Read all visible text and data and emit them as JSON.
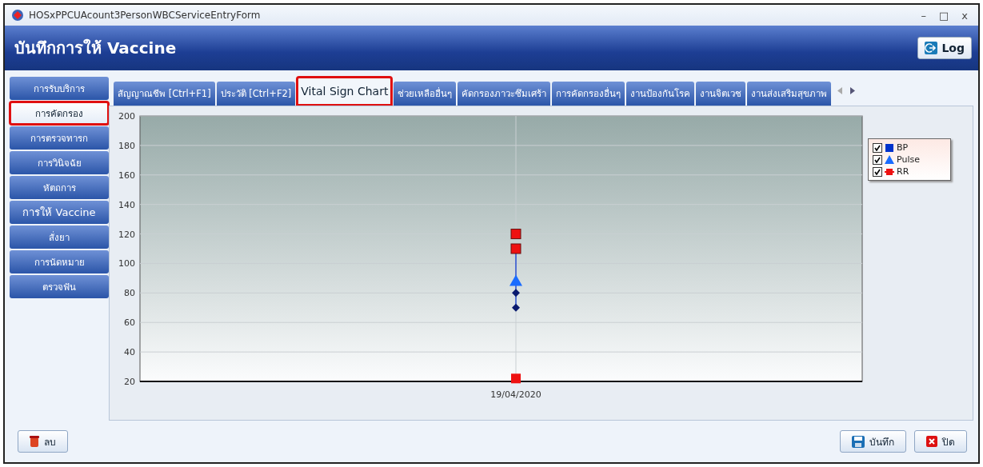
{
  "window": {
    "title": "HOSxPPCUAcount3PersonWBCServiceEntryForm",
    "controls": [
      "–",
      "□",
      "x"
    ]
  },
  "header": {
    "title": "บันทึกการให้ Vaccine",
    "log_button": "Log"
  },
  "sidebar": {
    "items": [
      {
        "label": "การรับบริการ",
        "selected": false,
        "highlighted": false
      },
      {
        "label": "การคัดกรอง",
        "selected": true,
        "highlighted": true
      },
      {
        "label": "การตรวจทารก",
        "selected": false,
        "highlighted": false
      },
      {
        "label": "การวินิจฉัย",
        "selected": false,
        "highlighted": false
      },
      {
        "label": "หัตถการ",
        "selected": false,
        "highlighted": false
      },
      {
        "label": "การให้ Vaccine",
        "selected": false,
        "highlighted": false
      },
      {
        "label": "สั่งยา",
        "selected": false,
        "highlighted": false
      },
      {
        "label": "การนัดหมาย",
        "selected": false,
        "highlighted": false
      },
      {
        "label": "ตรวจฟัน",
        "selected": false,
        "highlighted": false
      }
    ]
  },
  "tabs": [
    {
      "label": "สัญญาณชีพ [Ctrl+F1]",
      "selected": false,
      "highlighted": false
    },
    {
      "label": "ประวัติ [Ctrl+F2]",
      "selected": false,
      "highlighted": false
    },
    {
      "label": "Vital Sign Chart",
      "selected": true,
      "highlighted": true
    },
    {
      "label": "ช่วยเหลืออื่นๆ",
      "selected": false,
      "highlighted": false
    },
    {
      "label": "คัดกรองภาวะซึมเศร้า",
      "selected": false,
      "highlighted": false
    },
    {
      "label": "การคัดกรองอื่นๆ",
      "selected": false,
      "highlighted": false
    },
    {
      "label": "งานป้องกันโรค",
      "selected": false,
      "highlighted": false
    },
    {
      "label": "งานจิตเวช",
      "selected": false,
      "highlighted": false
    },
    {
      "label": "งานส่งเสริมสุขภาพ",
      "selected": false,
      "highlighted": false
    }
  ],
  "chart_data": {
    "type": "scatter",
    "categories": [
      "19/04/2020"
    ],
    "ylim": [
      20,
      200
    ],
    "yticks": [
      20,
      40,
      60,
      80,
      100,
      120,
      140,
      160,
      180,
      200
    ],
    "grid": true,
    "series": [
      {
        "color": "#0a1a6e",
        "values": [
          80
        ]
      },
      {
        "color": "#0a1a6e",
        "values": [
          70
        ]
      },
      {
        "color": "#1a6cff",
        "values": [
          88
        ]
      },
      {
        "color": "#ee1111",
        "values": [
          120
        ]
      },
      {
        "color": "#ee1111",
        "values": [
          110
        ]
      },
      {
        "color": "#ee1111",
        "values": [
          22
        ]
      }
    ]
  },
  "legend": [
    {
      "label": "BP",
      "checked": true,
      "kind": "square",
      "color": "#0033cc"
    },
    {
      "label": "Pulse",
      "checked": true,
      "kind": "triangle",
      "color": "#1a6cff"
    },
    {
      "label": "RR",
      "checked": true,
      "kind": "line-square",
      "color": "#ee1111"
    }
  ],
  "footer": {
    "delete_button": "ลบ",
    "save_button": "บันทึก",
    "close_button": "ปิด"
  }
}
